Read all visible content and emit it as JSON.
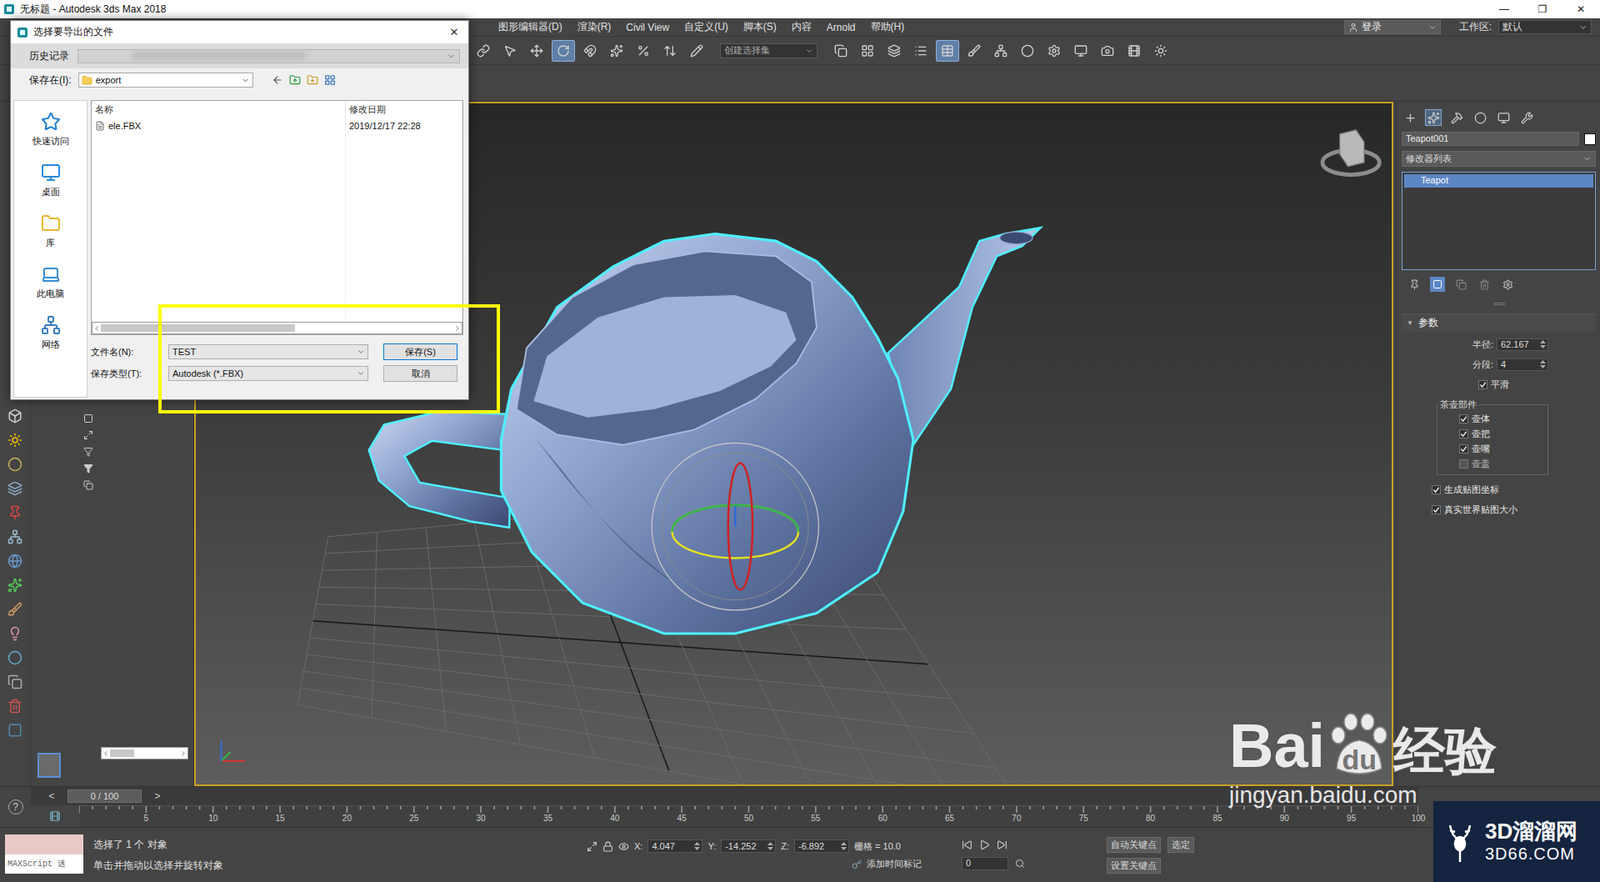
{
  "window": {
    "title": "无标题 - Autodesk 3ds Max 2018",
    "controls": [
      "—",
      "❐",
      "✕"
    ]
  },
  "menu": [
    {
      "label": "图形编辑器(D)"
    },
    {
      "label": "渲染(R)"
    },
    {
      "label": "Civil View"
    },
    {
      "label": "自定义(U)"
    },
    {
      "label": "脚本(S)"
    },
    {
      "label": "内容"
    },
    {
      "label": "Arnold"
    },
    {
      "label": "帮助(H)"
    }
  ],
  "account": {
    "label": "登录"
  },
  "workspace": {
    "label": "工作区:",
    "value": "默认"
  },
  "toolbar": {
    "tools_left": [
      {
        "selected": false
      },
      {
        "selected": false
      },
      {
        "selected": false
      },
      {
        "selected": true
      },
      {
        "selected": false
      },
      {
        "selected": false
      },
      {
        "selected": false
      },
      {
        "selected": false
      },
      {
        "selected": false
      }
    ],
    "selection_set": "创建选择集",
    "tools_right": [
      {
        "selected": false
      },
      {
        "selected": false
      },
      {
        "selected": false
      },
      {
        "selected": false
      },
      {
        "selected": true
      },
      {
        "selected": false
      },
      {
        "selected": false
      },
      {
        "selected": false
      },
      {
        "selected": false
      },
      {
        "selected": false
      },
      {
        "selected": false
      },
      {
        "selected": false
      },
      {
        "selected": false
      }
    ]
  },
  "dialog": {
    "title": "选择要导出的文件",
    "close": "✕",
    "history_label": "历史记录",
    "save_in_label": "保存在(I):",
    "save_in_value": "export",
    "places": [
      {
        "label": "快速访问"
      },
      {
        "label": "桌面"
      },
      {
        "label": "库"
      },
      {
        "label": "此电脑"
      },
      {
        "label": "网络"
      }
    ],
    "columns": [
      "名称",
      "修改日期"
    ],
    "files": [
      {
        "name": "ele.FBX",
        "modified": "2019/12/17 22:28",
        "selected": false
      }
    ],
    "fields": [
      {
        "label": "文件名(N):",
        "value": "TEST",
        "button": "保存(S)"
      },
      {
        "label": "保存类型(T):",
        "value": "Autodesk (*.FBX)",
        "button": "取消"
      }
    ]
  },
  "viewport": {
    "active": true
  },
  "command_panel": {
    "tabs": [
      {
        "selected": false
      },
      {
        "selected": true
      },
      {
        "selected": false
      },
      {
        "selected": false
      },
      {
        "selected": false
      },
      {
        "selected": false
      }
    ],
    "object_name": "Teapot001",
    "modifier_list": "修改器列表",
    "stack": [
      {
        "label": "Teapot",
        "selected": true
      }
    ],
    "rollout": {
      "toggle": "▼",
      "title": "参数",
      "expanded": true
    },
    "params": [
      {
        "label": "半径:",
        "value": "62.167"
      },
      {
        "label": "分段:",
        "value": "4"
      }
    ],
    "smooth": {
      "label": "平滑",
      "checked": true
    },
    "parts_group": "茶壶部件",
    "parts": [
      {
        "label": "壶体",
        "checked": true
      },
      {
        "label": "壶把",
        "checked": true
      },
      {
        "label": "壶嘴",
        "checked": true
      },
      {
        "label": "壶盖",
        "checked": false
      }
    ],
    "options": [
      {
        "label": "生成贴图坐标",
        "checked": true
      },
      {
        "label": "真实世界贴图大小",
        "checked": true
      }
    ]
  },
  "timeline": {
    "prev": "<",
    "frame": "0 / 100",
    "next": ">",
    "help": "?",
    "ticks": [
      "5",
      "10",
      "15",
      "20",
      "25",
      "30",
      "35",
      "40",
      "45",
      "50",
      "55",
      "60",
      "65",
      "70",
      "75",
      "80",
      "85",
      "90",
      "95",
      "100"
    ]
  },
  "status_bar": {
    "maxscript": "MAXScript 迷",
    "messages": [
      "选择了 1 个 对象",
      "单击并拖动以选择并旋转对象"
    ],
    "coords": [
      {
        "axis": "X:",
        "value": "4.047"
      },
      {
        "axis": "Y:",
        "value": "-14.252"
      },
      {
        "axis": "Z:",
        "value": "-6.892"
      }
    ],
    "grid": "栅格 = 10.0",
    "time_tag": "添加时间标记",
    "frame": "0",
    "auto_key": "自动关键点",
    "set_key": "设置关键点",
    "selected_key": "选定"
  },
  "watermark": {
    "brand_left": "Bai",
    "brand_paw": "du",
    "brand_right": "经验",
    "url": "jingyan.baidu.com",
    "site": "3D溜溜网",
    "site_url": "3D66.COM"
  }
}
